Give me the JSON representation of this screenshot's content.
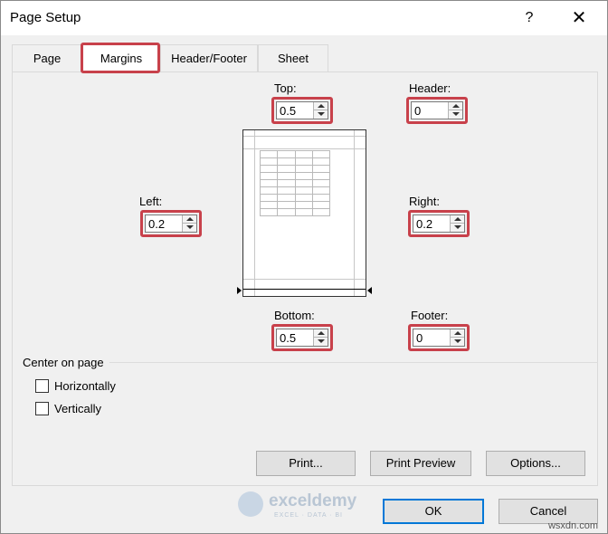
{
  "window": {
    "title": "Page Setup",
    "help": "?",
    "close": "✕"
  },
  "tabs": [
    {
      "label": "Page"
    },
    {
      "label": "Margins"
    },
    {
      "label": "Header/Footer"
    },
    {
      "label": "Sheet"
    }
  ],
  "fields": {
    "top": {
      "label": "Top:",
      "value": "0.5"
    },
    "header": {
      "label": "Header:",
      "value": "0"
    },
    "left": {
      "label": "Left:",
      "value": "0.2"
    },
    "right": {
      "label": "Right:",
      "value": "0.2"
    },
    "bottom": {
      "label": "Bottom:",
      "value": "0.5"
    },
    "footer": {
      "label": "Footer:",
      "value": "0"
    }
  },
  "center_on_page": {
    "label": "Center on page",
    "horizontally": "Horizontally",
    "vertically": "Vertically"
  },
  "buttons": {
    "print": "Print...",
    "print_preview": "Print Preview",
    "options": "Options...",
    "ok": "OK",
    "cancel": "Cancel"
  },
  "watermark": {
    "name": "exceldemy",
    "tagline": "EXCEL · DATA · BI"
  },
  "corner_text": "wsxdn.com",
  "colors": {
    "highlight": "#c8414b",
    "default_button_border": "#0078d7"
  }
}
